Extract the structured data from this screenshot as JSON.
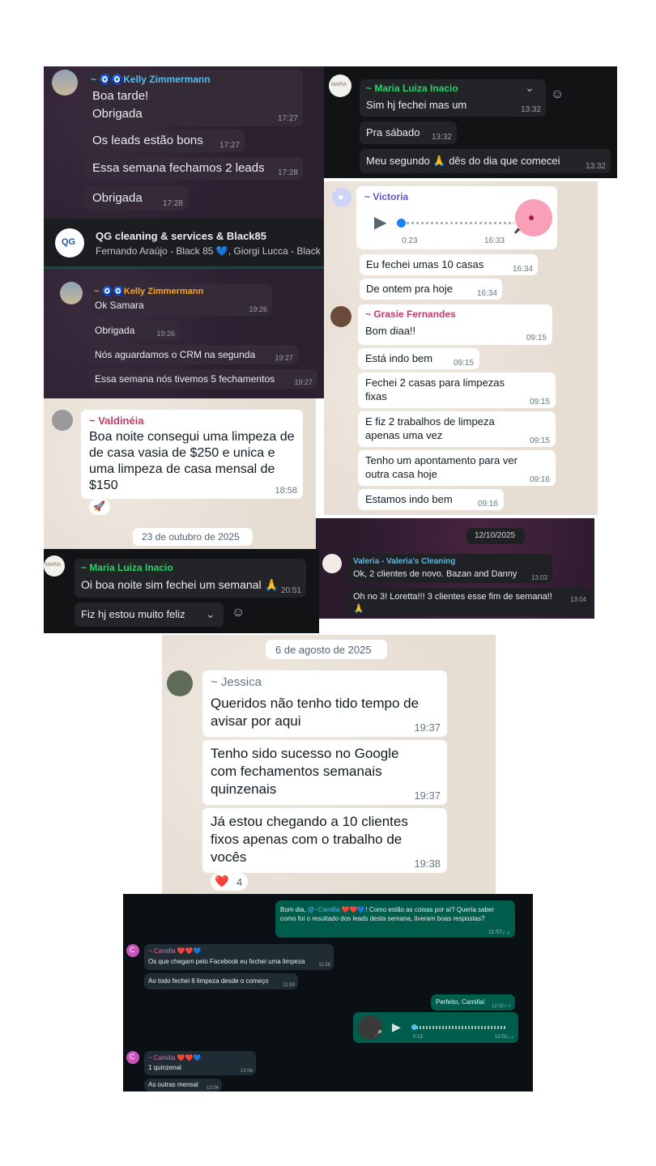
{
  "p1": {
    "sender": "~ 🧿🧿Kelly Zimmermann",
    "m1a": "Boa tarde!",
    "m1b": "Obrigada",
    "m1t": "17:27",
    "m2": "Os leads estão bons",
    "m2t": "17:27",
    "m3": "Essa semana fechamos 2 leads",
    "m3t": "17:28",
    "m4": "Obrigada",
    "m4t": "17:28"
  },
  "p2": {
    "sender": "~ Maria Luiza Inacio",
    "avatar_text": "MARIA",
    "m1": "Sim hj fechei mas um",
    "m1t": "13:32",
    "m2": "Pra sábado",
    "m2t": "13:32",
    "m3": "Meu segundo 🙏 dês do dia que comecei",
    "m3t": "13:32"
  },
  "p3": {
    "group_name": "QG cleaning & services & Black85",
    "members": "Fernando Araújo - Black 85 💙, Giorgi Lucca - Black",
    "avatar_text": "QG"
  },
  "p4": {
    "sender": "~ 🧿🧿Kelly Zimmermann",
    "m1": "Ok Samara",
    "m1t": "19:26",
    "m2": "Obrigada",
    "m2t": "19:26",
    "m3": "Nós aguardamos o CRM na segunda",
    "m3t": "19:27",
    "m4": "Essa semana nós tivemos 5 fechamentos",
    "m4t": "19:27"
  },
  "p5": {
    "sender": "~ Victoria",
    "audio_elapsed": "0:23",
    "audio_time": "16:33",
    "m1": "Eu fechei umas 10 casas",
    "m1t": "16:34",
    "m2": "De ontem pra hoje",
    "m2t": "16:34"
  },
  "p6": {
    "sender": "~ Grasie Fernandes",
    "m1": "Bom diaa!!",
    "m1t": "09:15",
    "m2": "Está indo bem",
    "m2t": "09:15",
    "m3": "Fechei 2 casas para limpezas fixas",
    "m3t": "09:15",
    "m4": "E fiz 2 trabalhos de limpeza apenas uma vez",
    "m4t": "09:15",
    "m5": "Tenho um apontamento para ver outra casa hoje",
    "m5t": "09:16",
    "m6": "Estamos indo bem",
    "m6t": "09:16"
  },
  "p7": {
    "sender": "~ Valdinéia",
    "m1": "Boa noite consegui uma limpeza de de casa vasia de $250 e unica e uma limpeza de casa mensal de $150",
    "m1t": "18:58",
    "reaction": "🚀",
    "date": "23 de outubro de 2025"
  },
  "p8": {
    "date": "12/10/2025",
    "sender": "Valeria - Valeria's Cleaning",
    "m1": "Ok, 2 clientes de novo. Bazan and Danny",
    "m1t": "13:03",
    "m2": "Oh no 3! Loretta!!! 3 clientes esse fim de semana!! 🙏",
    "m2t": "13:04"
  },
  "p9": {
    "sender": "~ Maria Luiza Inacio",
    "avatar_text": "MARIA",
    "m1": "Oi boa noite sim fechei um semanal 🙏",
    "m1t": "20:51",
    "m2": "Fiz hj estou muito feliz"
  },
  "p10": {
    "date": "6 de agosto de 2025",
    "sender": "~ Jessica",
    "m1": "Queridos não tenho tido tempo de avisar por aqui",
    "m1t": "19:37",
    "m2": "Tenho sido sucesso no Google com fechamentos semanais quinzenais",
    "m2t": "19:37",
    "m3": "Já estou chegando a 10 clientes fixos apenas com o trabalho de vocês",
    "m3t": "19:38",
    "reaction": "❤️",
    "reaction_count": "4"
  },
  "p11": {
    "out1_a": "Bom dia, ",
    "out1_mention": "@~Camilla ❤️❤️💙",
    "out1_b": "! Como estão as coisas por aí? Queria saber como foi o resultado dos leads desta semana, tiveram boas respostas?",
    "out1t": "11:57",
    "sender": "~ Camilla ❤️❤️💙",
    "avatar_letter": "C",
    "in1": "Os que chegam pelo Facebook eu fechei uma limpeza",
    "in1t": "11:58",
    "in2": "Ao todo fechei 6 limpeza desde o começo",
    "in2t": "11:59",
    "out2": "Perfeito, Camilla!",
    "out2t": "12:02",
    "audio_elapsed": "0:13",
    "audio_time": "12:02",
    "in3": "1 quinzenal",
    "in3t": "12:04",
    "in4": "As outras mensal",
    "in4t": "12:04"
  }
}
